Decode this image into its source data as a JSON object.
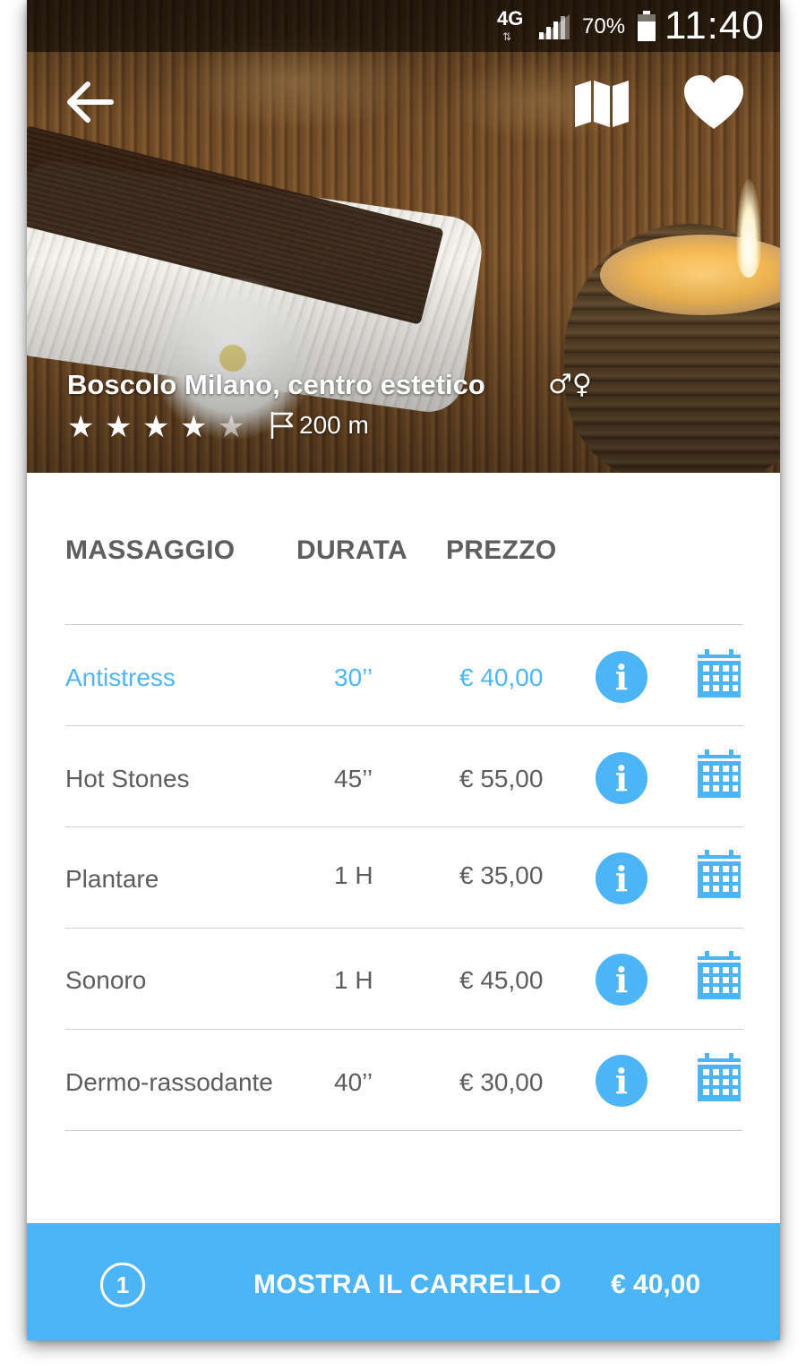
{
  "status_bar": {
    "network": "4G",
    "battery_percent": "70%",
    "time": "11:40"
  },
  "header": {
    "icons": [
      "back-arrow-icon",
      "map-icon",
      "heart-icon"
    ],
    "place_name": "Boscolo Milano, centro estetico",
    "gender_symbols": "♂♀",
    "rating": 4,
    "rating_max": 5,
    "distance": "200 m"
  },
  "table": {
    "columns": [
      "MASSAGGIO",
      "DURATA",
      "PREZZO"
    ],
    "rows": [
      {
        "name": "Antistress",
        "duration": "30’’",
        "price": "€ 40,00",
        "selected": true
      },
      {
        "name": "Hot Stones",
        "duration": "45’’",
        "price": "€ 55,00",
        "selected": false
      },
      {
        "name": "Plantare",
        "duration": "1 H",
        "price": "€ 35,00",
        "selected": false
      },
      {
        "name": "Sonoro",
        "duration": "1 H",
        "price": "€ 45,00",
        "selected": false
      },
      {
        "name": "Dermo-rassodante",
        "duration": "40’’",
        "price": "€ 30,00",
        "selected": false
      }
    ],
    "info_icon_glyph": "i"
  },
  "cart": {
    "count": "1",
    "label": "MOSTRA IL CARRELLO",
    "total": "€ 40,00"
  },
  "colors": {
    "accent": "#4db5f6",
    "text": "#5d5d5d",
    "divider": "#cfcfcf"
  }
}
